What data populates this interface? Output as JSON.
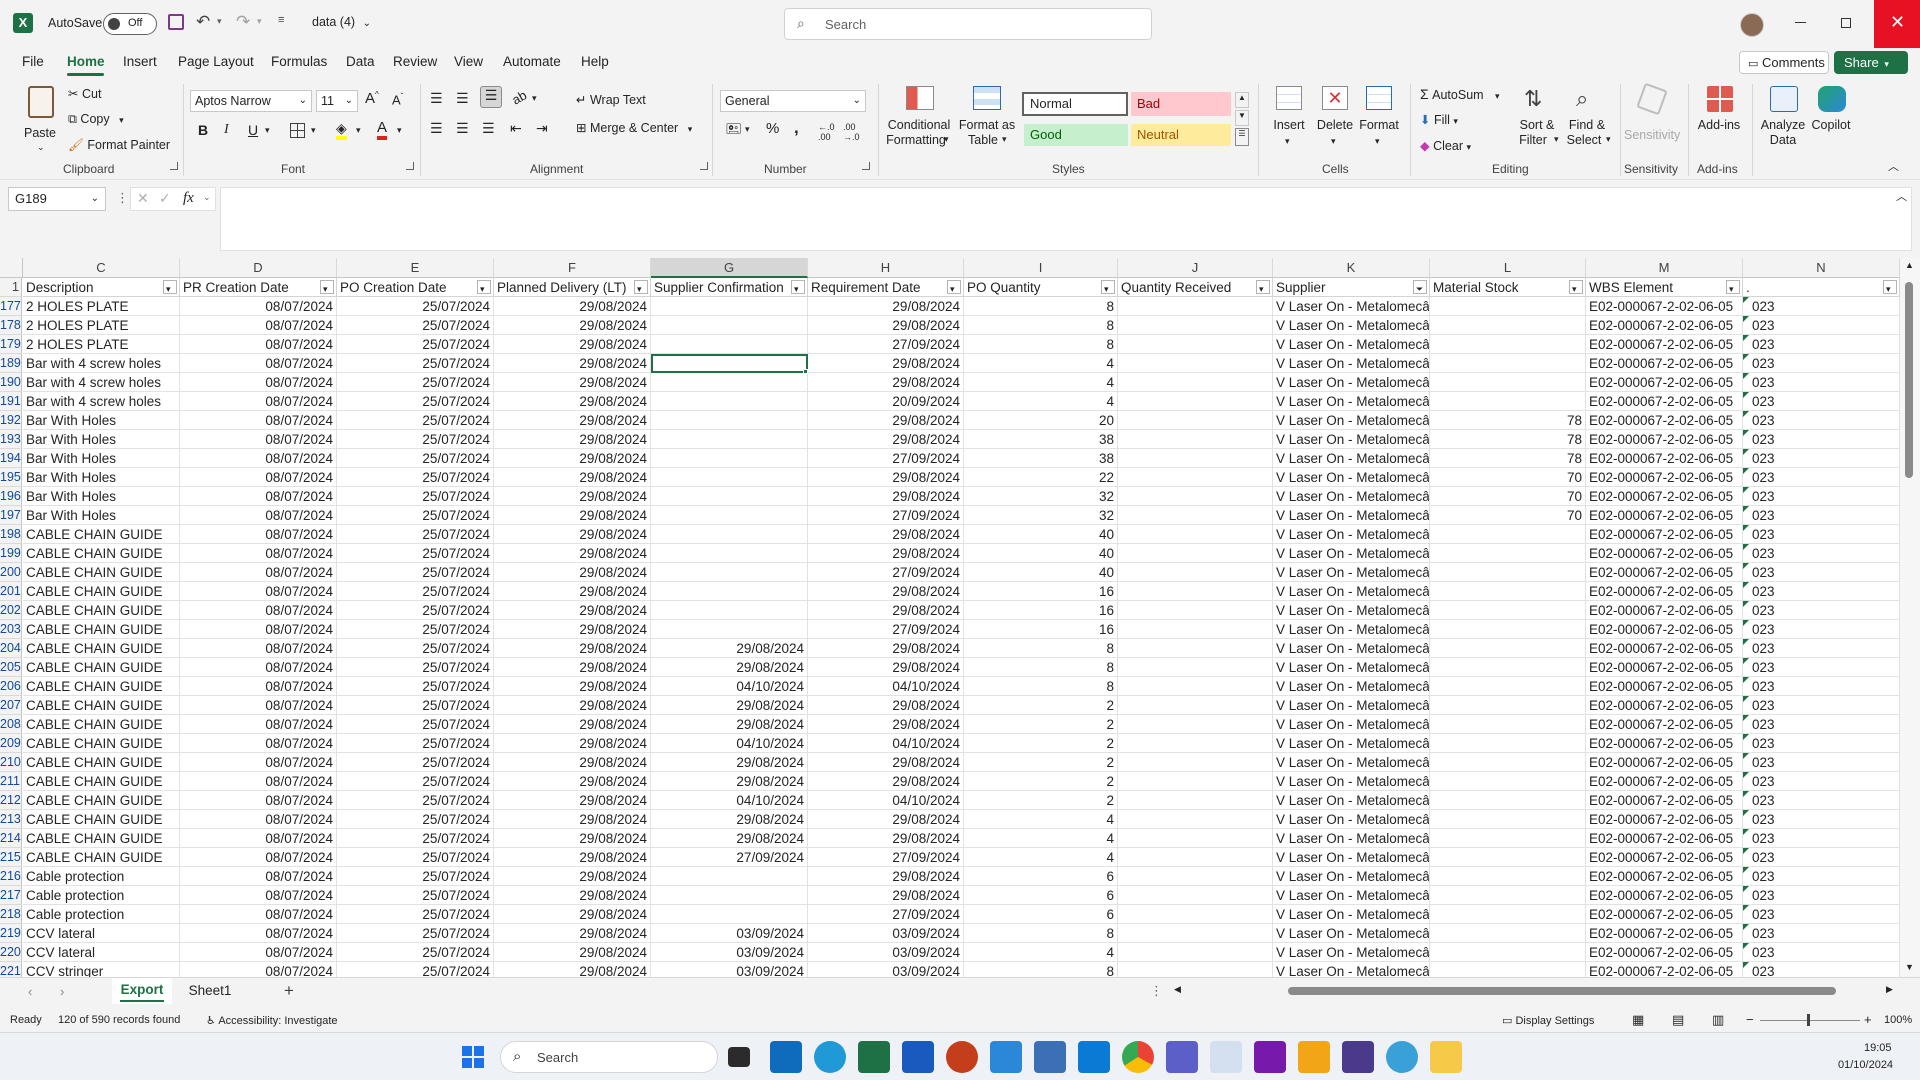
{
  "titlebar": {
    "autosave_label": "AutoSave",
    "autosave_state": "Off",
    "filename": "data (4)",
    "search_placeholder": "Search"
  },
  "menu": {
    "tabs": [
      "File",
      "Home",
      "Insert",
      "Page Layout",
      "Formulas",
      "Data",
      "Review",
      "View",
      "Automate",
      "Help"
    ],
    "active": "Home",
    "comments_label": "Comments",
    "share_label": "Share"
  },
  "ribbon": {
    "clipboard": {
      "paste": "Paste",
      "cut": "Cut",
      "copy": "Copy",
      "format_painter": "Format Painter",
      "group": "Clipboard"
    },
    "font": {
      "name": "Aptos Narrow",
      "size": "11",
      "group": "Font"
    },
    "alignment": {
      "wrap_text": "Wrap Text",
      "merge_center": "Merge & Center",
      "group": "Alignment"
    },
    "number": {
      "format": "General",
      "group": "Number"
    },
    "styles": {
      "conditional_1": "Conditional",
      "conditional_2": "Formatting",
      "format_table_1": "Format as",
      "format_table_2": "Table",
      "normal": "Normal",
      "bad": "Bad",
      "good": "Good",
      "neutral": "Neutral",
      "group": "Styles"
    },
    "cells": {
      "insert": "Insert",
      "delete": "Delete",
      "format": "Format",
      "group": "Cells"
    },
    "editing": {
      "autosum": "AutoSum",
      "fill": "Fill",
      "clear": "Clear",
      "sort_1": "Sort &",
      "sort_2": "Filter",
      "find_1": "Find &",
      "find_2": "Select",
      "group": "Editing"
    },
    "sensitivity": {
      "label": "Sensitivity",
      "group": "Sensitivity"
    },
    "addins": {
      "label": "Add-ins",
      "group": "Add-ins"
    },
    "analyze": {
      "label_1": "Analyze",
      "label_2": "Data"
    },
    "copilot": {
      "label": "Copilot"
    }
  },
  "formula_bar": {
    "name_box": "G189",
    "fx": "fx",
    "formula": ""
  },
  "grid": {
    "col_letters": [
      "C",
      "D",
      "E",
      "F",
      "G",
      "H",
      "I",
      "J",
      "K",
      "L",
      "M",
      "N"
    ],
    "headers": [
      "Description",
      "PR Creation Date",
      "PO Creation Date",
      "Planned Delivery (LT)",
      "Supplier Confirmation",
      "Requirement Date",
      "PO Quantity",
      "Quantity Received",
      "Supplier",
      "Material Stock",
      "WBS Element",
      "."
    ],
    "header_row_number": "1",
    "rows": [
      {
        "n": "177",
        "c": [
          "2 HOLES PLATE",
          "08/07/2024",
          "25/07/2024",
          "29/08/2024",
          "",
          "29/08/2024",
          "8",
          "",
          "V Laser On - Metalomecânica, SA",
          "",
          "E02-000067-2-02-06-05",
          "023"
        ]
      },
      {
        "n": "178",
        "c": [
          "2 HOLES PLATE",
          "08/07/2024",
          "25/07/2024",
          "29/08/2024",
          "",
          "29/08/2024",
          "8",
          "",
          "V Laser On - Metalomecânica, SA",
          "",
          "E02-000067-2-02-06-05",
          "023"
        ]
      },
      {
        "n": "179",
        "c": [
          "2 HOLES PLATE",
          "08/07/2024",
          "25/07/2024",
          "29/08/2024",
          "",
          "27/09/2024",
          "8",
          "",
          "V Laser On - Metalomecânica, SA",
          "",
          "E02-000067-2-02-06-05",
          "023"
        ]
      },
      {
        "n": "189",
        "c": [
          "Bar with 4 screw holes",
          "08/07/2024",
          "25/07/2024",
          "29/08/2024",
          "",
          "29/08/2024",
          "4",
          "",
          "V Laser On - Metalomecânica, SA",
          "",
          "E02-000067-2-02-06-05",
          "023"
        ]
      },
      {
        "n": "190",
        "c": [
          "Bar with 4 screw holes",
          "08/07/2024",
          "25/07/2024",
          "29/08/2024",
          "",
          "29/08/2024",
          "4",
          "",
          "V Laser On - Metalomecânica, SA",
          "",
          "E02-000067-2-02-06-05",
          "023"
        ]
      },
      {
        "n": "191",
        "c": [
          "Bar with 4 screw holes",
          "08/07/2024",
          "25/07/2024",
          "29/08/2024",
          "",
          "20/09/2024",
          "4",
          "",
          "V Laser On - Metalomecânica, SA",
          "",
          "E02-000067-2-02-06-05",
          "023"
        ]
      },
      {
        "n": "192",
        "c": [
          "Bar With Holes",
          "08/07/2024",
          "25/07/2024",
          "29/08/2024",
          "",
          "29/08/2024",
          "20",
          "",
          "V Laser On - Metalomecâ",
          "78",
          "E02-000067-2-02-06-05",
          "023"
        ]
      },
      {
        "n": "193",
        "c": [
          "Bar With Holes",
          "08/07/2024",
          "25/07/2024",
          "29/08/2024",
          "",
          "29/08/2024",
          "38",
          "",
          "V Laser On - Metalomecâ",
          "78",
          "E02-000067-2-02-06-05",
          "023"
        ]
      },
      {
        "n": "194",
        "c": [
          "Bar With Holes",
          "08/07/2024",
          "25/07/2024",
          "29/08/2024",
          "",
          "27/09/2024",
          "38",
          "",
          "V Laser On - Metalomecâ",
          "78",
          "E02-000067-2-02-06-05",
          "023"
        ]
      },
      {
        "n": "195",
        "c": [
          "Bar With Holes",
          "08/07/2024",
          "25/07/2024",
          "29/08/2024",
          "",
          "29/08/2024",
          "22",
          "",
          "V Laser On - Metalomecâ",
          "70",
          "E02-000067-2-02-06-05",
          "023"
        ]
      },
      {
        "n": "196",
        "c": [
          "Bar With Holes",
          "08/07/2024",
          "25/07/2024",
          "29/08/2024",
          "",
          "29/08/2024",
          "32",
          "",
          "V Laser On - Metalomecâ",
          "70",
          "E02-000067-2-02-06-05",
          "023"
        ]
      },
      {
        "n": "197",
        "c": [
          "Bar With Holes",
          "08/07/2024",
          "25/07/2024",
          "29/08/2024",
          "",
          "27/09/2024",
          "32",
          "",
          "V Laser On - Metalomecâ",
          "70",
          "E02-000067-2-02-06-05",
          "023"
        ]
      },
      {
        "n": "198",
        "c": [
          "CABLE CHAIN GUIDE",
          "08/07/2024",
          "25/07/2024",
          "29/08/2024",
          "",
          "29/08/2024",
          "40",
          "",
          "V Laser On - Metalomecânica, SA",
          "",
          "E02-000067-2-02-06-05",
          "023"
        ]
      },
      {
        "n": "199",
        "c": [
          "CABLE CHAIN GUIDE",
          "08/07/2024",
          "25/07/2024",
          "29/08/2024",
          "",
          "29/08/2024",
          "40",
          "",
          "V Laser On - Metalomecânica, SA",
          "",
          "E02-000067-2-02-06-05",
          "023"
        ]
      },
      {
        "n": "200",
        "c": [
          "CABLE CHAIN GUIDE",
          "08/07/2024",
          "25/07/2024",
          "29/08/2024",
          "",
          "27/09/2024",
          "40",
          "",
          "V Laser On - Metalomecânica, SA",
          "",
          "E02-000067-2-02-06-05",
          "023"
        ]
      },
      {
        "n": "201",
        "c": [
          "CABLE CHAIN GUIDE",
          "08/07/2024",
          "25/07/2024",
          "29/08/2024",
          "",
          "29/08/2024",
          "16",
          "",
          "V Laser On - Metalomecânica, SA",
          "",
          "E02-000067-2-02-06-05",
          "023"
        ]
      },
      {
        "n": "202",
        "c": [
          "CABLE CHAIN GUIDE",
          "08/07/2024",
          "25/07/2024",
          "29/08/2024",
          "",
          "29/08/2024",
          "16",
          "",
          "V Laser On - Metalomecânica, SA",
          "",
          "E02-000067-2-02-06-05",
          "023"
        ]
      },
      {
        "n": "203",
        "c": [
          "CABLE CHAIN GUIDE",
          "08/07/2024",
          "25/07/2024",
          "29/08/2024",
          "",
          "27/09/2024",
          "16",
          "",
          "V Laser On - Metalomecânica, SA",
          "",
          "E02-000067-2-02-06-05",
          "023"
        ]
      },
      {
        "n": "204",
        "c": [
          "CABLE CHAIN GUIDE",
          "08/07/2024",
          "25/07/2024",
          "29/08/2024",
          "29/08/2024",
          "29/08/2024",
          "8",
          "",
          "V Laser On - Metalomecânica, SA",
          "",
          "E02-000067-2-02-06-05",
          "023"
        ]
      },
      {
        "n": "205",
        "c": [
          "CABLE CHAIN GUIDE",
          "08/07/2024",
          "25/07/2024",
          "29/08/2024",
          "29/08/2024",
          "29/08/2024",
          "8",
          "",
          "V Laser On - Metalomecânica, SA",
          "",
          "E02-000067-2-02-06-05",
          "023"
        ]
      },
      {
        "n": "206",
        "c": [
          "CABLE CHAIN GUIDE",
          "08/07/2024",
          "25/07/2024",
          "29/08/2024",
          "04/10/2024",
          "04/10/2024",
          "8",
          "",
          "V Laser On - Metalomecânica, SA",
          "",
          "E02-000067-2-02-06-05",
          "023"
        ]
      },
      {
        "n": "207",
        "c": [
          "CABLE CHAIN GUIDE",
          "08/07/2024",
          "25/07/2024",
          "29/08/2024",
          "29/08/2024",
          "29/08/2024",
          "2",
          "",
          "V Laser On - Metalomecânica, SA",
          "",
          "E02-000067-2-02-06-05",
          "023"
        ]
      },
      {
        "n": "208",
        "c": [
          "CABLE CHAIN GUIDE",
          "08/07/2024",
          "25/07/2024",
          "29/08/2024",
          "29/08/2024",
          "29/08/2024",
          "2",
          "",
          "V Laser On - Metalomecânica, SA",
          "",
          "E02-000067-2-02-06-05",
          "023"
        ]
      },
      {
        "n": "209",
        "c": [
          "CABLE CHAIN GUIDE",
          "08/07/2024",
          "25/07/2024",
          "29/08/2024",
          "04/10/2024",
          "04/10/2024",
          "2",
          "",
          "V Laser On - Metalomecânica, SA",
          "",
          "E02-000067-2-02-06-05",
          "023"
        ]
      },
      {
        "n": "210",
        "c": [
          "CABLE CHAIN GUIDE",
          "08/07/2024",
          "25/07/2024",
          "29/08/2024",
          "29/08/2024",
          "29/08/2024",
          "2",
          "",
          "V Laser On - Metalomecânica, SA",
          "",
          "E02-000067-2-02-06-05",
          "023"
        ]
      },
      {
        "n": "211",
        "c": [
          "CABLE CHAIN GUIDE",
          "08/07/2024",
          "25/07/2024",
          "29/08/2024",
          "29/08/2024",
          "29/08/2024",
          "2",
          "",
          "V Laser On - Metalomecânica, SA",
          "",
          "E02-000067-2-02-06-05",
          "023"
        ]
      },
      {
        "n": "212",
        "c": [
          "CABLE CHAIN GUIDE",
          "08/07/2024",
          "25/07/2024",
          "29/08/2024",
          "04/10/2024",
          "04/10/2024",
          "2",
          "",
          "V Laser On - Metalomecânica, SA",
          "",
          "E02-000067-2-02-06-05",
          "023"
        ]
      },
      {
        "n": "213",
        "c": [
          "CABLE CHAIN GUIDE",
          "08/07/2024",
          "25/07/2024",
          "29/08/2024",
          "29/08/2024",
          "29/08/2024",
          "4",
          "",
          "V Laser On - Metalomecânica, SA",
          "",
          "E02-000067-2-02-06-05",
          "023"
        ]
      },
      {
        "n": "214",
        "c": [
          "CABLE CHAIN GUIDE",
          "08/07/2024",
          "25/07/2024",
          "29/08/2024",
          "29/08/2024",
          "29/08/2024",
          "4",
          "",
          "V Laser On - Metalomecânica, SA",
          "",
          "E02-000067-2-02-06-05",
          "023"
        ]
      },
      {
        "n": "215",
        "c": [
          "CABLE CHAIN GUIDE",
          "08/07/2024",
          "25/07/2024",
          "29/08/2024",
          "27/09/2024",
          "27/09/2024",
          "4",
          "",
          "V Laser On - Metalomecânica, SA",
          "",
          "E02-000067-2-02-06-05",
          "023"
        ]
      },
      {
        "n": "216",
        "c": [
          "Cable protection",
          "08/07/2024",
          "25/07/2024",
          "29/08/2024",
          "",
          "29/08/2024",
          "6",
          "",
          "V Laser On - Metalomecânica, SA",
          "",
          "E02-000067-2-02-06-05",
          "023"
        ]
      },
      {
        "n": "217",
        "c": [
          "Cable protection",
          "08/07/2024",
          "25/07/2024",
          "29/08/2024",
          "",
          "29/08/2024",
          "6",
          "",
          "V Laser On - Metalomecânica, SA",
          "",
          "E02-000067-2-02-06-05",
          "023"
        ]
      },
      {
        "n": "218",
        "c": [
          "Cable protection",
          "08/07/2024",
          "25/07/2024",
          "29/08/2024",
          "",
          "27/09/2024",
          "6",
          "",
          "V Laser On - Metalomecânica, SA",
          "",
          "E02-000067-2-02-06-05",
          "023"
        ]
      },
      {
        "n": "219",
        "c": [
          "CCV lateral",
          "08/07/2024",
          "25/07/2024",
          "29/08/2024",
          "03/09/2024",
          "03/09/2024",
          "8",
          "",
          "V Laser On - Metalomecânica, SA",
          "",
          "E02-000067-2-02-06-05",
          "023"
        ]
      },
      {
        "n": "220",
        "c": [
          "CCV lateral",
          "08/07/2024",
          "25/07/2024",
          "29/08/2024",
          "03/09/2024",
          "03/09/2024",
          "4",
          "",
          "V Laser On - Metalomecânica, SA",
          "",
          "E02-000067-2-02-06-05",
          "023"
        ]
      },
      {
        "n": "221",
        "c": [
          "CCV stringer",
          "08/07/2024",
          "25/07/2024",
          "29/08/2024",
          "03/09/2024",
          "03/09/2024",
          "8",
          "",
          "V Laser On - Metalomecânica, SA",
          "",
          "E02-000067-2-02-06-05",
          "023"
        ]
      }
    ]
  },
  "sheets": {
    "tabs": [
      "Export",
      "Sheet1"
    ],
    "active": "Export"
  },
  "status": {
    "ready": "Ready",
    "records": "120 of 590 records found",
    "accessibility": "Accessibility: Investigate",
    "display_settings": "Display Settings",
    "zoom": "100%"
  },
  "taskbar": {
    "search_placeholder": "Search",
    "time": "19:05",
    "date": "01/10/2024"
  }
}
